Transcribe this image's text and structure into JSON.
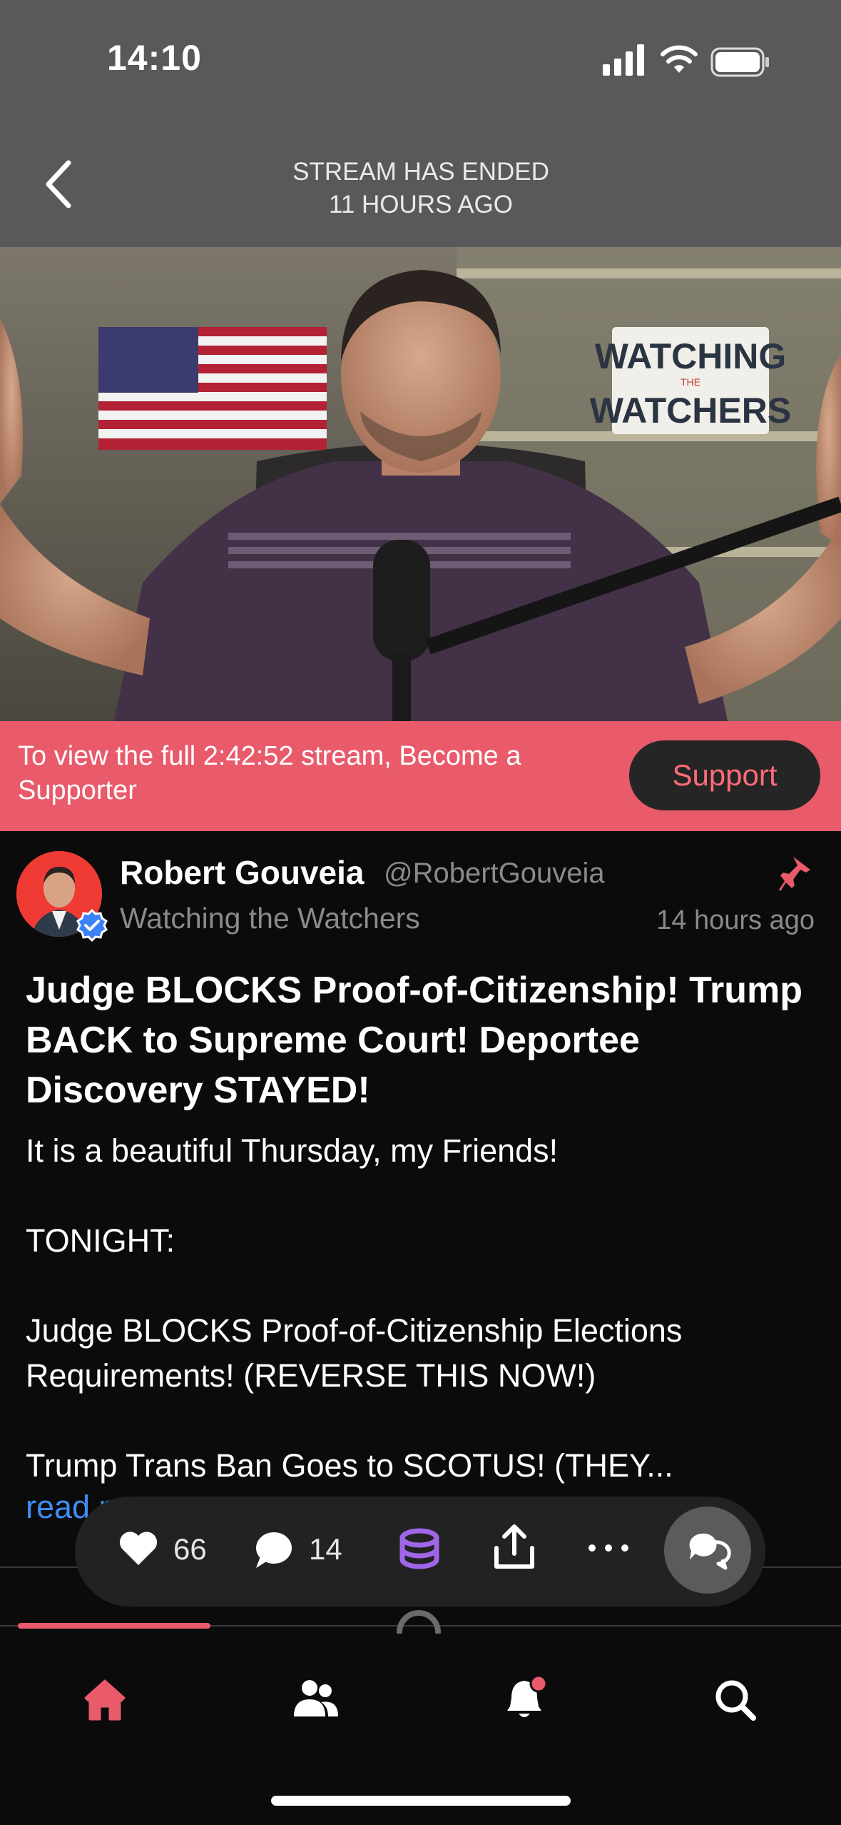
{
  "status_bar": {
    "time": "14:10"
  },
  "header": {
    "title_line1": "STREAM HAS ENDED",
    "title_line2": "11 HOURS AGO"
  },
  "video": {
    "sign_text_1": "WATCHING",
    "sign_text_2": "THE",
    "sign_text_3": "WATCHERS"
  },
  "banner": {
    "text": "To view the full 2:42:52 stream, Become a Supporter",
    "button_label": "Support"
  },
  "post": {
    "author_name": "Robert Gouveia",
    "author_handle": "@RobertGouveia",
    "channel_name": "Watching the Watchers",
    "time_ago": "14 hours ago",
    "title": "Judge BLOCKS Proof-of-Citizenship! Trump BACK to Supreme Court! Deportee Discovery STAYED!",
    "body": {
      "p1": "It is a beautiful Thursday, my Friends!",
      "p2": "TONIGHT:",
      "p3": "Judge BLOCKS Proof-of-Citizenship Elections Requirements! (REVERSE THIS NOW!)",
      "p4": "Trump Trans Ban Goes to SCOTUS! (THEY..."
    },
    "read_more": "read more"
  },
  "actions": {
    "likes": "66",
    "comments": "14"
  },
  "colors": {
    "accent": "#e95a6b",
    "link": "#3f8cf5",
    "coins": "#a066e8"
  },
  "icons": [
    "back-icon",
    "pin-icon",
    "heart-icon",
    "comment-icon",
    "coins-icon",
    "share-icon",
    "more-icon",
    "chat-icon",
    "home-icon",
    "people-icon",
    "bell-icon",
    "search-icon"
  ]
}
